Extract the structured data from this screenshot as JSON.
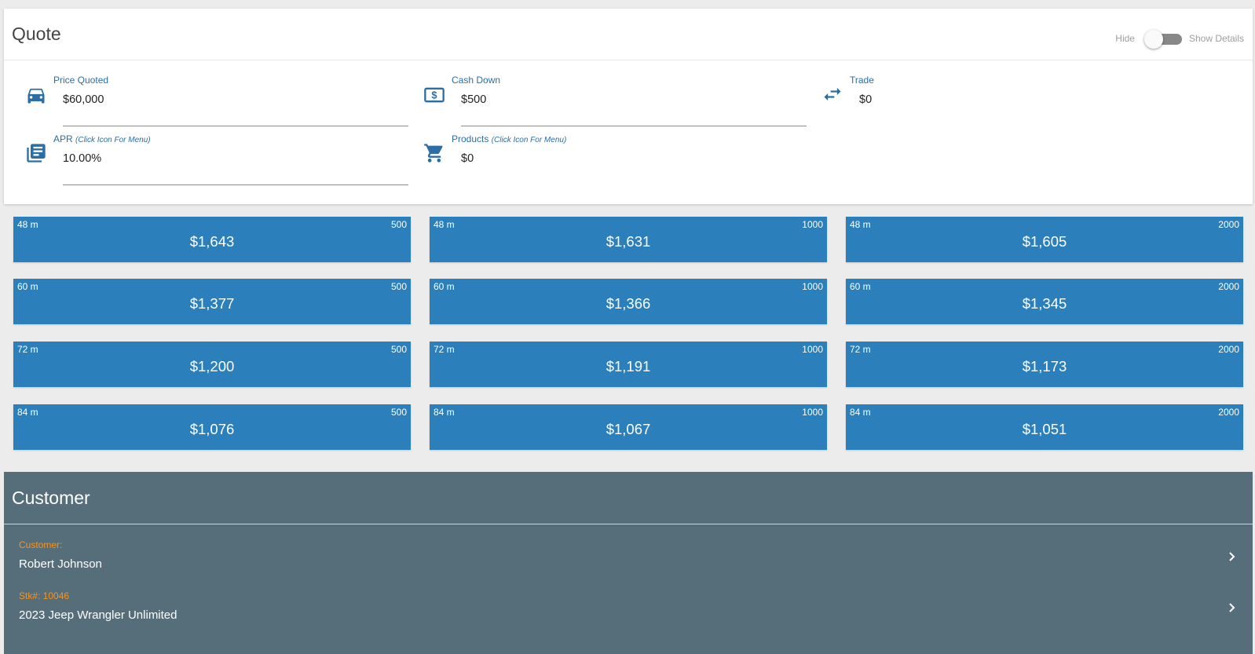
{
  "quote": {
    "title": "Quote",
    "toggle_hide_label": "Hide",
    "toggle_show_label": "Show Details",
    "price": {
      "label": "Price Quoted",
      "value": "$60,000",
      "icon": "car-icon"
    },
    "cash_down": {
      "label": "Cash Down",
      "value": "$500",
      "icon": "cash-icon"
    },
    "trade": {
      "label": "Trade",
      "value": "$0",
      "icon": "swap-icon"
    },
    "apr": {
      "label": "APR",
      "hint": "(Click Icon For Menu)",
      "value": "10.00%",
      "icon": "list-icon"
    },
    "products": {
      "label": "Products",
      "hint": "(Click Icon For Menu)",
      "value": "$0",
      "icon": "cart-icon"
    }
  },
  "payments": [
    {
      "term": "48 m",
      "down": "500",
      "amount": "$1,643"
    },
    {
      "term": "48 m",
      "down": "1000",
      "amount": "$1,631"
    },
    {
      "term": "48 m",
      "down": "2000",
      "amount": "$1,605"
    },
    {
      "term": "60 m",
      "down": "500",
      "amount": "$1,377"
    },
    {
      "term": "60 m",
      "down": "1000",
      "amount": "$1,366"
    },
    {
      "term": "60 m",
      "down": "2000",
      "amount": "$1,345"
    },
    {
      "term": "72 m",
      "down": "500",
      "amount": "$1,200"
    },
    {
      "term": "72 m",
      "down": "1000",
      "amount": "$1,191"
    },
    {
      "term": "72 m",
      "down": "2000",
      "amount": "$1,173"
    },
    {
      "term": "84 m",
      "down": "500",
      "amount": "$1,076"
    },
    {
      "term": "84 m",
      "down": "1000",
      "amount": "$1,067"
    },
    {
      "term": "84 m",
      "down": "2000",
      "amount": "$1,051"
    }
  ],
  "customer": {
    "title": "Customer",
    "customer_label": "Customer:",
    "customer_name": "Robert Johnson",
    "stock_label": "Stk#: 10046",
    "vehicle": "2023 Jeep Wrangler Unlimited"
  },
  "colors": {
    "accent": "#2b7fba",
    "customer_bg": "#566e79",
    "label_orange": "#f7931e",
    "field_label": "#2b6ea6"
  }
}
